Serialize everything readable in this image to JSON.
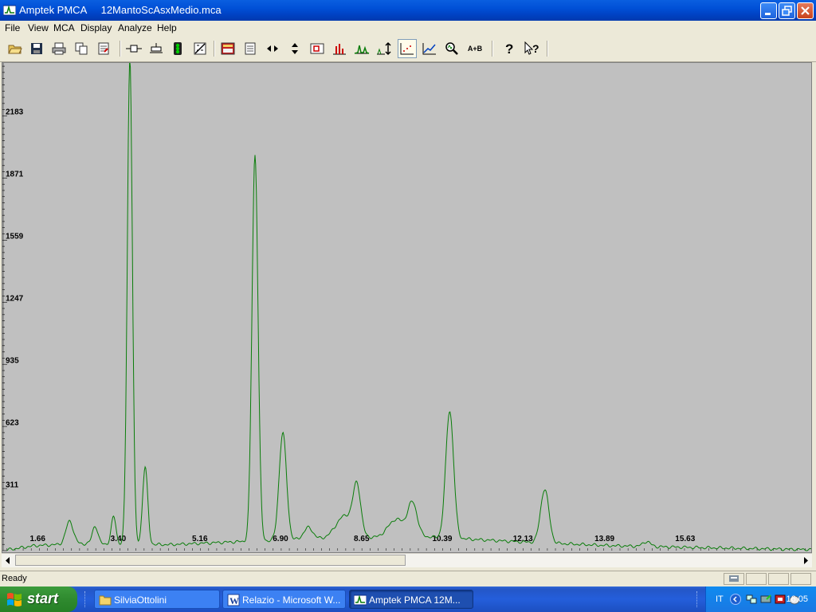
{
  "window": {
    "title": "Amptek PMCA     12MantoScAsxMedio.mca"
  },
  "menubar": {
    "items": [
      "File",
      "View",
      "MCA",
      "Display",
      "Analyze",
      "Help"
    ]
  },
  "toolbar": {
    "buttons": [
      {
        "icon": "open-folder-icon"
      },
      {
        "icon": "save-icon"
      },
      {
        "icon": "print-icon"
      },
      {
        "icon": "copy-icon"
      },
      {
        "icon": "report-icon"
      },
      {
        "icon": "roi-marker-icon"
      },
      {
        "icon": "roi-clear-icon"
      },
      {
        "icon": "traffic-light-icon"
      },
      {
        "icon": "calibration-icon"
      },
      {
        "icon": "spectrum-view-icon"
      },
      {
        "icon": "page-icon"
      },
      {
        "icon": "horizontal-expand-icon"
      },
      {
        "icon": "vertical-expand-icon"
      },
      {
        "icon": "zoom-box-icon"
      },
      {
        "icon": "bar-chart-icon"
      },
      {
        "icon": "peaks-icon"
      },
      {
        "icon": "auto-scale-icon"
      },
      {
        "icon": "dot-plot-icon",
        "pressed": true
      },
      {
        "icon": "line-plot-icon"
      },
      {
        "icon": "magnifier-icon"
      },
      {
        "icon": "a-plus-b-icon",
        "label": "A+B"
      },
      {
        "icon": "help-icon"
      },
      {
        "icon": "context-help-icon"
      }
    ]
  },
  "chart_data": {
    "type": "line",
    "color": "#0a7d0a",
    "background": "#c0c0c0",
    "xlabel": "",
    "ylabel": "",
    "x_tick_labels": [
      "1.66",
      "3.40",
      "5.16",
      "6.90",
      "8.65",
      "10.39",
      "12.13",
      "13.89",
      "15.63"
    ],
    "y_tick_labels": [
      "311",
      "623",
      "935",
      "1247",
      "1559",
      "1871",
      "2183"
    ],
    "xlim": [
      0.9,
      18.35
    ],
    "ylim": [
      0,
      2450
    ],
    "grid": false,
    "baseline": [
      {
        "x": 0.9,
        "y": 0
      },
      {
        "x": 1.6,
        "y": 25
      },
      {
        "x": 2.5,
        "y": 35
      },
      {
        "x": 4.5,
        "y": 30
      },
      {
        "x": 6.0,
        "y": 45
      },
      {
        "x": 8.0,
        "y": 60
      },
      {
        "x": 10.0,
        "y": 70
      },
      {
        "x": 12.0,
        "y": 45
      },
      {
        "x": 14.0,
        "y": 25
      },
      {
        "x": 16.0,
        "y": 15
      },
      {
        "x": 18.35,
        "y": 5
      }
    ],
    "peaks": [
      {
        "x": 2.35,
        "y": 115,
        "width": 0.08
      },
      {
        "x": 2.9,
        "y": 90,
        "width": 0.06
      },
      {
        "x": 3.3,
        "y": 140,
        "width": 0.05
      },
      {
        "x": 3.65,
        "y": 2440,
        "width": 0.055
      },
      {
        "x": 3.98,
        "y": 390,
        "width": 0.055
      },
      {
        "x": 6.35,
        "y": 1940,
        "width": 0.065
      },
      {
        "x": 6.95,
        "y": 540,
        "width": 0.08
      },
      {
        "x": 7.5,
        "y": 60,
        "width": 0.1
      },
      {
        "x": 8.3,
        "y": 115,
        "width": 0.2
      },
      {
        "x": 8.55,
        "y": 230,
        "width": 0.08
      },
      {
        "x": 9.4,
        "y": 90,
        "width": 0.18
      },
      {
        "x": 9.75,
        "y": 165,
        "width": 0.1
      },
      {
        "x": 10.55,
        "y": 640,
        "width": 0.085
      },
      {
        "x": 12.6,
        "y": 270,
        "width": 0.09
      },
      {
        "x": 14.8,
        "y": 25,
        "width": 0.08
      }
    ]
  },
  "status": {
    "text": "Ready"
  },
  "taskbar": {
    "start_label": "start",
    "tasks": [
      {
        "label": "SilviaOttolini",
        "icon": "folder-icon"
      },
      {
        "label": "Relazio - Microsoft W...",
        "icon": "word-icon"
      },
      {
        "label": "Amptek PMCA     12M...",
        "icon": "pmca-app-icon",
        "active": true
      }
    ],
    "tray": {
      "language": "IT",
      "clock": "16.05"
    }
  },
  "colors": {
    "titlebar": "#0054e3",
    "plot_bg": "#c0c0c0",
    "trace": "#0a7d0a",
    "taskbar": "#245edb",
    "start_button": "#3c9c3c"
  }
}
